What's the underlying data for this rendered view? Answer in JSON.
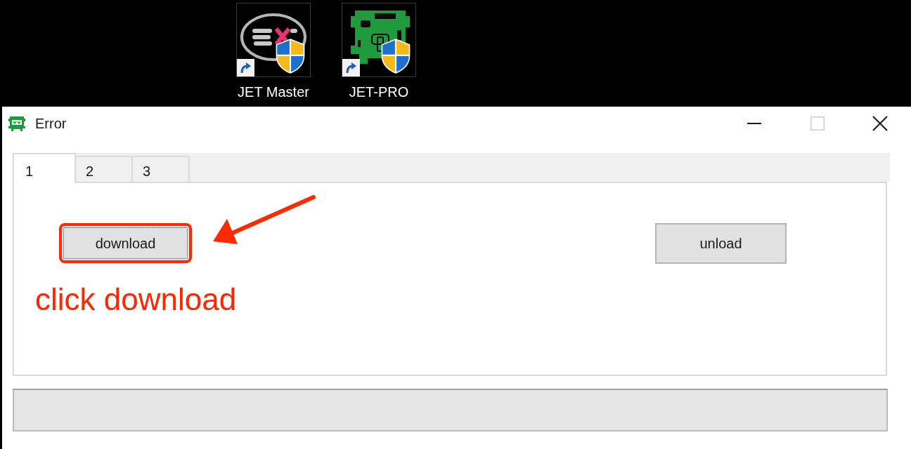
{
  "desktop": {
    "icons": [
      {
        "label": "JET Master",
        "kind": "ring"
      },
      {
        "label": "JET-PRO",
        "kind": "board"
      }
    ]
  },
  "window": {
    "title": "Error",
    "maximize_disabled": true
  },
  "tabs": [
    {
      "label": "1",
      "selected": true
    },
    {
      "label": "2",
      "selected": false
    },
    {
      "label": "3",
      "selected": false
    }
  ],
  "panel": {
    "buttons": [
      {
        "label": "download",
        "highlighted": true,
        "focused": true
      },
      {
        "label": "unload",
        "highlighted": false,
        "focused": false
      }
    ],
    "annotation": {
      "text": "click download"
    }
  }
}
